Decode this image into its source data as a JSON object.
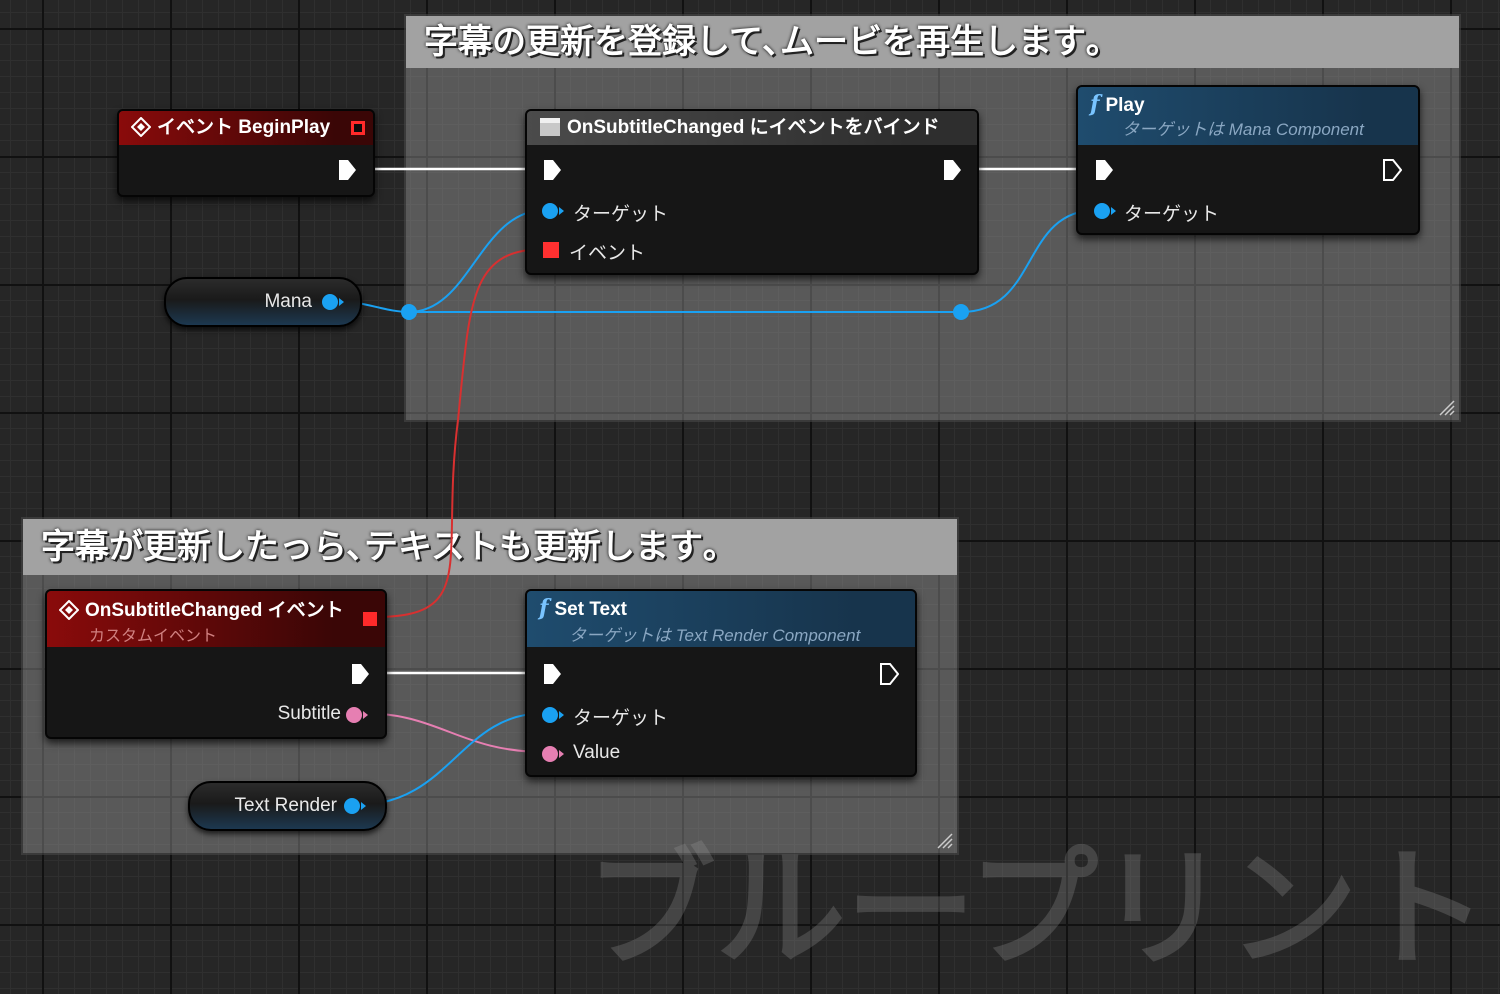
{
  "comments": {
    "top": {
      "title": "字幕の更新を登録して､ムービを再生します｡"
    },
    "bottom": {
      "title": "字幕が更新したっら､テキストも更新します｡"
    }
  },
  "nodes": {
    "begin_play": {
      "title": "イベント BeginPlay"
    },
    "bind_event": {
      "title": "OnSubtitleChanged にイベントをバインド",
      "pins": {
        "target": "ターゲット",
        "event": "イベント"
      }
    },
    "play": {
      "title": "Play",
      "subtitle": "ターゲットは Mana Component",
      "pins": {
        "target": "ターゲット"
      }
    },
    "custom_event": {
      "title": "OnSubtitleChanged イベント",
      "subtitle": "カスタムイベント",
      "pins": {
        "subtitle": "Subtitle"
      }
    },
    "set_text": {
      "title": "Set Text",
      "subtitle": "ターゲットは Text Render Component",
      "pins": {
        "target": "ターゲット",
        "value": "Value"
      }
    },
    "mana_var": {
      "label": "Mana"
    },
    "text_render_var": {
      "label": "Text Render"
    }
  },
  "watermark": "ブループリント",
  "colors": {
    "exec": "#ffffff",
    "object_pin": "#1aa1f2",
    "delegate_pin": "#ff3838",
    "string_pin": "#e67fb2",
    "event_header": "#8a0b0b",
    "function_header": "#1f4c6e"
  },
  "icons": {
    "event": "diamond-event-icon",
    "function": "function-f-icon",
    "macro": "bind-node-icon"
  }
}
